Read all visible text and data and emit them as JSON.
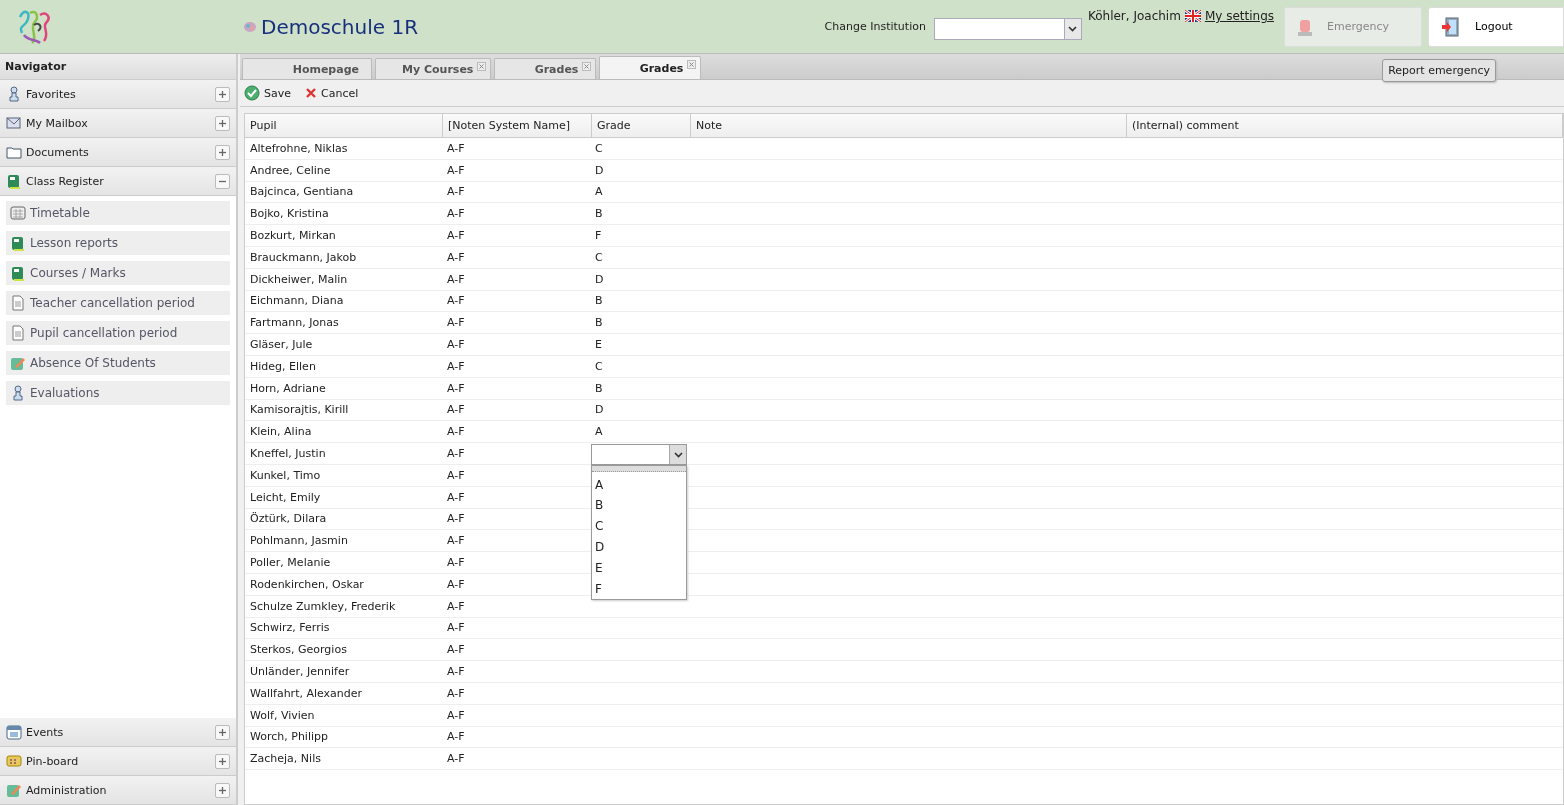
{
  "header": {
    "school": "Demoschule 1R",
    "change_institution_label": "Change Institution",
    "user": "Köhler, Joachim",
    "settings_link": "My settings",
    "emergency_button": {
      "label": "Emergency",
      "disabled": true
    },
    "logout_button": "Logout",
    "tooltip": "Report emergency"
  },
  "navigator": {
    "title": "Navigator",
    "sections": [
      {
        "label": "Favorites",
        "kind": "person",
        "expanded": false
      },
      {
        "label": "My Mailbox",
        "kind": "mail",
        "expanded": false
      },
      {
        "label": "Documents",
        "kind": "folder",
        "expanded": false
      },
      {
        "label": "Class Register",
        "kind": "book",
        "expanded": true,
        "children": [
          {
            "label": "Timetable",
            "kind": "calendar"
          },
          {
            "label": "Lesson reports",
            "kind": "book"
          },
          {
            "label": "Courses / Marks",
            "kind": "book"
          },
          {
            "label": "Teacher cancellation period",
            "kind": "doc"
          },
          {
            "label": "Pupil cancellation period",
            "kind": "doc"
          },
          {
            "label": "Absence Of Students",
            "kind": "pencil"
          },
          {
            "label": "Evaluations",
            "kind": "person"
          }
        ]
      }
    ],
    "bottom_sections": [
      {
        "label": "Events",
        "kind": "calendar",
        "expanded": false
      },
      {
        "label": "Pin-board",
        "kind": "board",
        "expanded": false
      },
      {
        "label": "Administration",
        "kind": "pencil",
        "expanded": false
      }
    ]
  },
  "tabs": [
    {
      "label": "Homepage",
      "closable": false,
      "selected": false
    },
    {
      "label": "My Courses",
      "closable": true,
      "selected": false
    },
    {
      "label": "Grades",
      "closable": true,
      "selected": false
    },
    {
      "label": "Grades",
      "closable": true,
      "selected": true
    }
  ],
  "toolbar": {
    "save": "Save",
    "cancel": "Cancel"
  },
  "table": {
    "columns": [
      "Pupil",
      "[Noten System Name]",
      "Grade",
      "Note",
      "(Internal) comment"
    ],
    "rows": [
      {
        "pupil": "Altefrohne, Niklas",
        "system": "A-F",
        "grade": "C"
      },
      {
        "pupil": "Andree, Celine",
        "system": "A-F",
        "grade": "D"
      },
      {
        "pupil": "Bajcinca, Gentiana",
        "system": "A-F",
        "grade": "A"
      },
      {
        "pupil": "Bojko, Kristina",
        "system": "A-F",
        "grade": "B"
      },
      {
        "pupil": "Bozkurt, Mirkan",
        "system": "A-F",
        "grade": "F"
      },
      {
        "pupil": "Brauckmann, Jakob",
        "system": "A-F",
        "grade": "C"
      },
      {
        "pupil": "Dickheiwer, Malin",
        "system": "A-F",
        "grade": "D"
      },
      {
        "pupil": "Eichmann, Diana",
        "system": "A-F",
        "grade": "B"
      },
      {
        "pupil": "Fartmann, Jonas",
        "system": "A-F",
        "grade": "B"
      },
      {
        "pupil": "Gläser, Jule",
        "system": "A-F",
        "grade": "E"
      },
      {
        "pupil": "Hideg, Ellen",
        "system": "A-F",
        "grade": "C"
      },
      {
        "pupil": "Horn, Adriane",
        "system": "A-F",
        "grade": "B"
      },
      {
        "pupil": "Kamisorajtis, Kirill",
        "system": "A-F",
        "grade": "D"
      },
      {
        "pupil": "Klein, Alina",
        "system": "A-F",
        "grade": "A"
      },
      {
        "pupil": "Kneffel, Justin",
        "system": "A-F",
        "editor": {
          "options": [
            "A",
            "B",
            "C",
            "D",
            "E",
            "F"
          ]
        }
      },
      {
        "pupil": "Kunkel, Timo",
        "system": "A-F"
      },
      {
        "pupil": "Leicht, Emily",
        "system": "A-F"
      },
      {
        "pupil": "Öztürk, Dilara",
        "system": "A-F"
      },
      {
        "pupil": "Pohlmann, Jasmin",
        "system": "A-F"
      },
      {
        "pupil": "Poller, Melanie",
        "system": "A-F"
      },
      {
        "pupil": "Rodenkirchen, Oskar",
        "system": "A-F"
      },
      {
        "pupil": "Schulze Zumkley, Frederik",
        "system": "A-F"
      },
      {
        "pupil": "Schwirz, Ferris",
        "system": "A-F"
      },
      {
        "pupil": "Sterkos, Georgios",
        "system": "A-F"
      },
      {
        "pupil": "Unländer, Jennifer",
        "system": "A-F"
      },
      {
        "pupil": "Wallfahrt, Alexander",
        "system": "A-F"
      },
      {
        "pupil": "Wolf, Vivien",
        "system": "A-F"
      },
      {
        "pupil": "Worch, Philipp",
        "system": "A-F"
      },
      {
        "pupil": "Zacheja, Nils",
        "system": "A-F"
      }
    ]
  }
}
